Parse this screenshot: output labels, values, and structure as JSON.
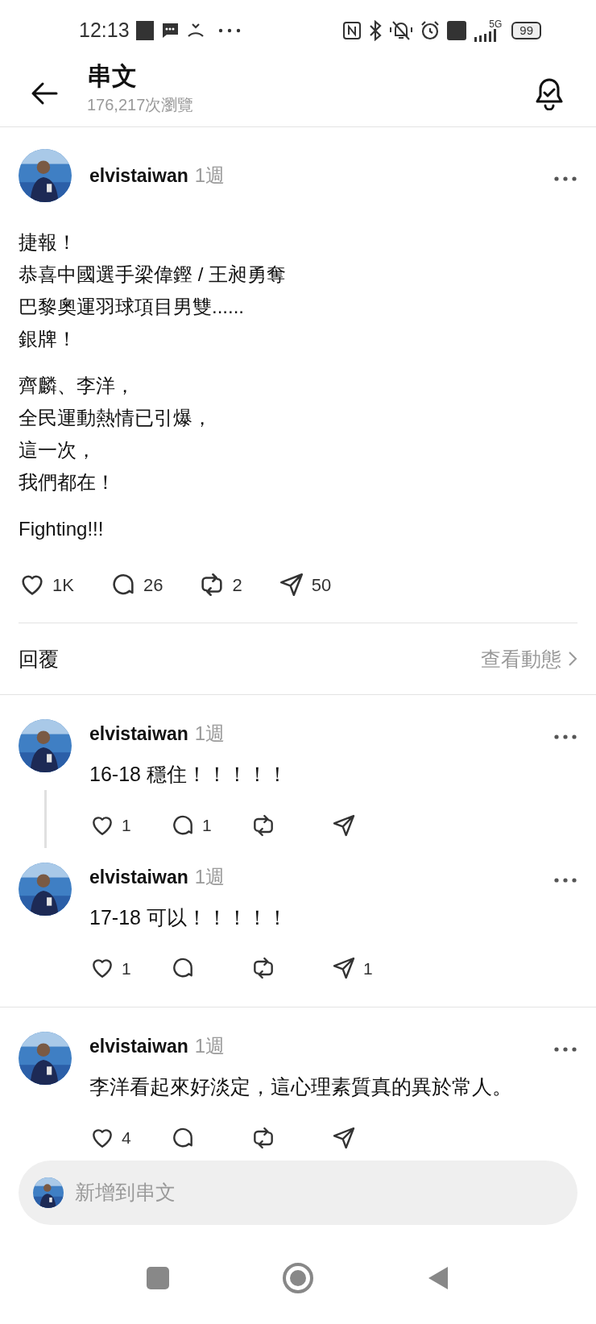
{
  "status_bar": {
    "time": "12:13",
    "network": "5G",
    "battery": "99"
  },
  "header": {
    "title": "串文",
    "subtitle": "176,217次瀏覽"
  },
  "post": {
    "username": "elvistaiwan",
    "time": "1週",
    "paragraphs": [
      [
        "捷報！",
        "恭喜中國選手梁偉鏗 / 王昶勇奪",
        "巴黎奧運羽球項目男雙......",
        "銀牌！"
      ],
      [
        "齊麟、李洋，",
        "全民運動熱情已引爆，",
        "這一次，",
        "我們都在！"
      ],
      [
        "Fighting!!!"
      ]
    ],
    "actions": [
      {
        "kind": "like",
        "count": "1K"
      },
      {
        "kind": "comment",
        "count": "26"
      },
      {
        "kind": "repost",
        "count": "2"
      },
      {
        "kind": "share",
        "count": "50"
      }
    ]
  },
  "replies_bar": {
    "label": "回覆",
    "link": "查看動態"
  },
  "threads": [
    {
      "replies": [
        {
          "username": "elvistaiwan",
          "time": "1週",
          "text": "16-18 穩住！！！！！",
          "actions": [
            {
              "kind": "like",
              "count": "1"
            },
            {
              "kind": "comment",
              "count": "1"
            },
            {
              "kind": "repost"
            },
            {
              "kind": "share"
            }
          ]
        },
        {
          "username": "elvistaiwan",
          "time": "1週",
          "text": "17-18 可以！！！！！",
          "actions": [
            {
              "kind": "like",
              "count": "1"
            },
            {
              "kind": "comment"
            },
            {
              "kind": "repost"
            },
            {
              "kind": "share",
              "count": "1"
            }
          ]
        }
      ]
    },
    {
      "replies": [
        {
          "username": "elvistaiwan",
          "time": "1週",
          "text": "李洋看起來好淡定，這心理素質真的異於常人。",
          "actions": [
            {
              "kind": "like",
              "count": "4"
            },
            {
              "kind": "comment"
            },
            {
              "kind": "repost"
            },
            {
              "kind": "share"
            }
          ]
        }
      ]
    }
  ],
  "composer": {
    "placeholder": "新增到串文"
  }
}
